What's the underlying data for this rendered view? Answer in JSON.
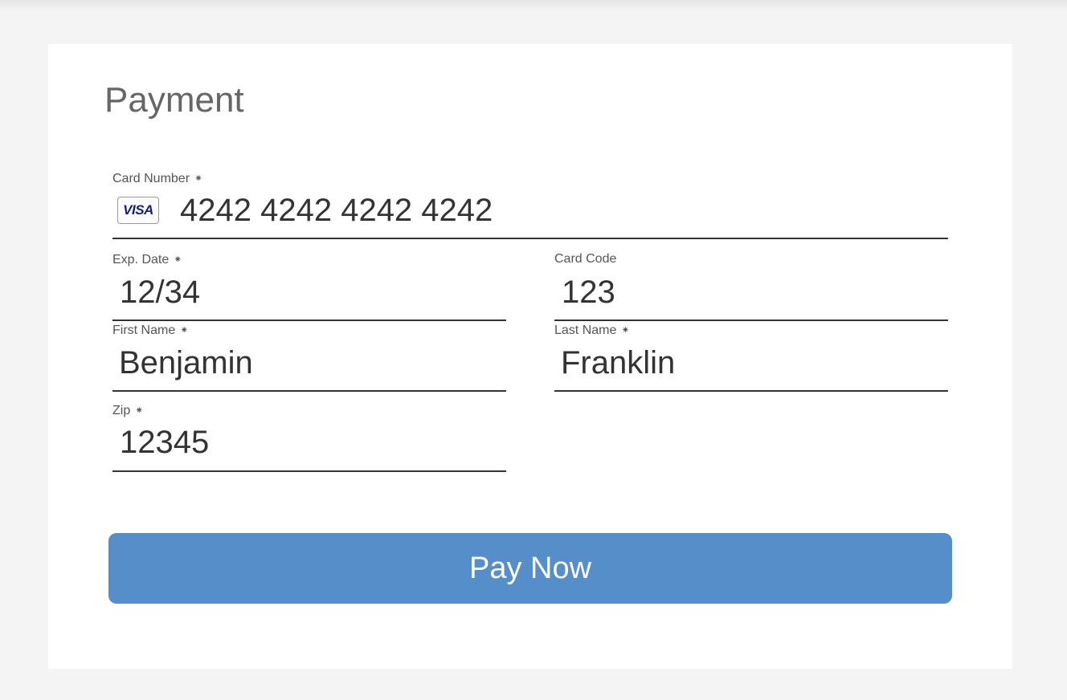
{
  "form": {
    "title": "Payment",
    "required_marker": "⁕",
    "card_number": {
      "label": "Card Number",
      "value": "4242 4242 4242 4242",
      "brand": "VISA"
    },
    "exp_date": {
      "label": "Exp. Date",
      "value": "12/34"
    },
    "card_code": {
      "label": "Card Code",
      "value": "123"
    },
    "first_name": {
      "label": "First Name",
      "value": "Benjamin"
    },
    "last_name": {
      "label": "Last Name",
      "value": "Franklin"
    },
    "zip": {
      "label": "Zip",
      "value": "12345"
    },
    "submit_label": "Pay Now"
  },
  "colors": {
    "page_background": "#f4f4f4",
    "card_background": "#ffffff",
    "button": "#558ec9",
    "button_text": "#ffffff",
    "title_text": "#666666",
    "value_text": "#333333",
    "visa_brand": "#1a1f71"
  }
}
